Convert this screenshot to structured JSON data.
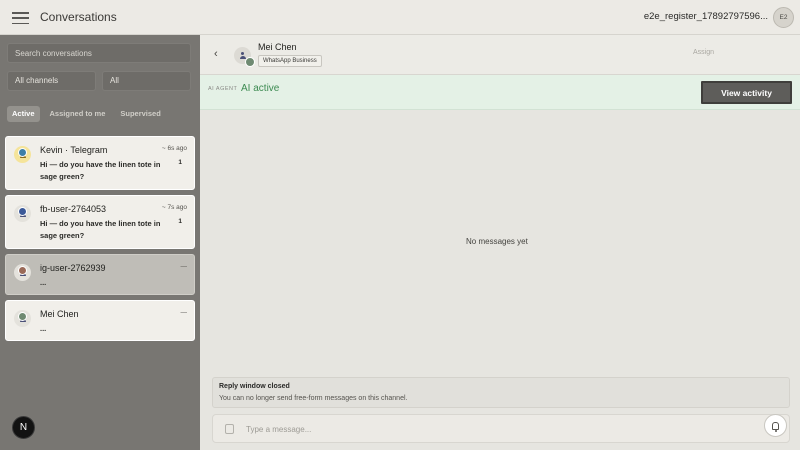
{
  "header": {
    "title": "Conversations",
    "account_name": "e2e_register_17892797596...",
    "account_initials": "E2"
  },
  "sidebar": {
    "search_placeholder": "Search conversations",
    "channel_filter": "All channels",
    "status_filter": "All",
    "tabs": [
      {
        "label": "Active",
        "active": true
      },
      {
        "label": "Assigned to me",
        "active": false
      },
      {
        "label": "Supervised",
        "active": false
      }
    ],
    "conversations": [
      {
        "name": "Kevin · Telegram",
        "time": "~ 6s ago",
        "preview": "Hi — do you have the linen tote in sage green?",
        "unread": "1",
        "channel_icon": "telegram-icon"
      },
      {
        "name": "fb-user-2764053",
        "time": "~ 7s ago",
        "preview": "Hi — do you have the linen tote in sage green?",
        "unread": "1",
        "channel_icon": "facebook-icon"
      },
      {
        "name": "ig-user-2762939",
        "time": "—",
        "preview": "...",
        "unread": "",
        "channel_icon": "instagram-icon"
      },
      {
        "name": "Mei Chen",
        "time": "—",
        "preview": "...",
        "unread": "",
        "channel_icon": "whatsapp-icon"
      }
    ],
    "bottom_button": "N"
  },
  "conversation": {
    "contact_name": "Mei Chen",
    "channel": "WhatsApp Business",
    "assign_label": "Assign",
    "ai_label": "AI AGENT",
    "ai_status": "AI active",
    "view_activity_label": "View activity",
    "empty_state": "No messages yet",
    "reply_closed_title": "Reply window closed",
    "reply_closed_text": "You can no longer send free-form messages on this channel.",
    "composer_placeholder": "Type a message..."
  },
  "colors": {
    "ai_active": "#3d8b52",
    "sidebar_bg": "#787672",
    "ai_bar_bg": "#e4f1e6"
  }
}
